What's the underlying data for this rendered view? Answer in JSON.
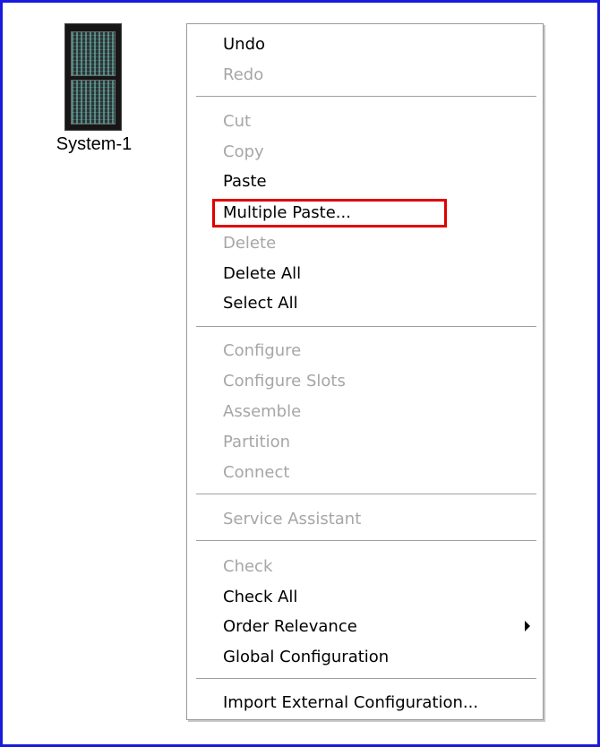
{
  "desktop": {
    "system_icon_name": "server-rack-icon",
    "system_label": "System-1"
  },
  "context_menu": {
    "undo": "Undo",
    "redo": "Redo",
    "cut": "Cut",
    "copy": "Copy",
    "paste": "Paste",
    "multiple_paste": "Multiple Paste...",
    "delete": "Delete",
    "delete_all": "Delete All",
    "select_all": "Select All",
    "configure": "Configure",
    "configure_slots": "Configure Slots",
    "assemble": "Assemble",
    "partition": "Partition",
    "connect": "Connect",
    "service_assistant": "Service Assistant",
    "check": "Check",
    "check_all": "Check All",
    "order_relevance": "Order Relevance",
    "global_configuration": "Global Configuration",
    "import_external_configuration": "Import External Configuration..."
  },
  "colors": {
    "frame_border": "#1a1adc",
    "highlight_box": "#e00000",
    "disabled_text": "#a6a6a6"
  }
}
